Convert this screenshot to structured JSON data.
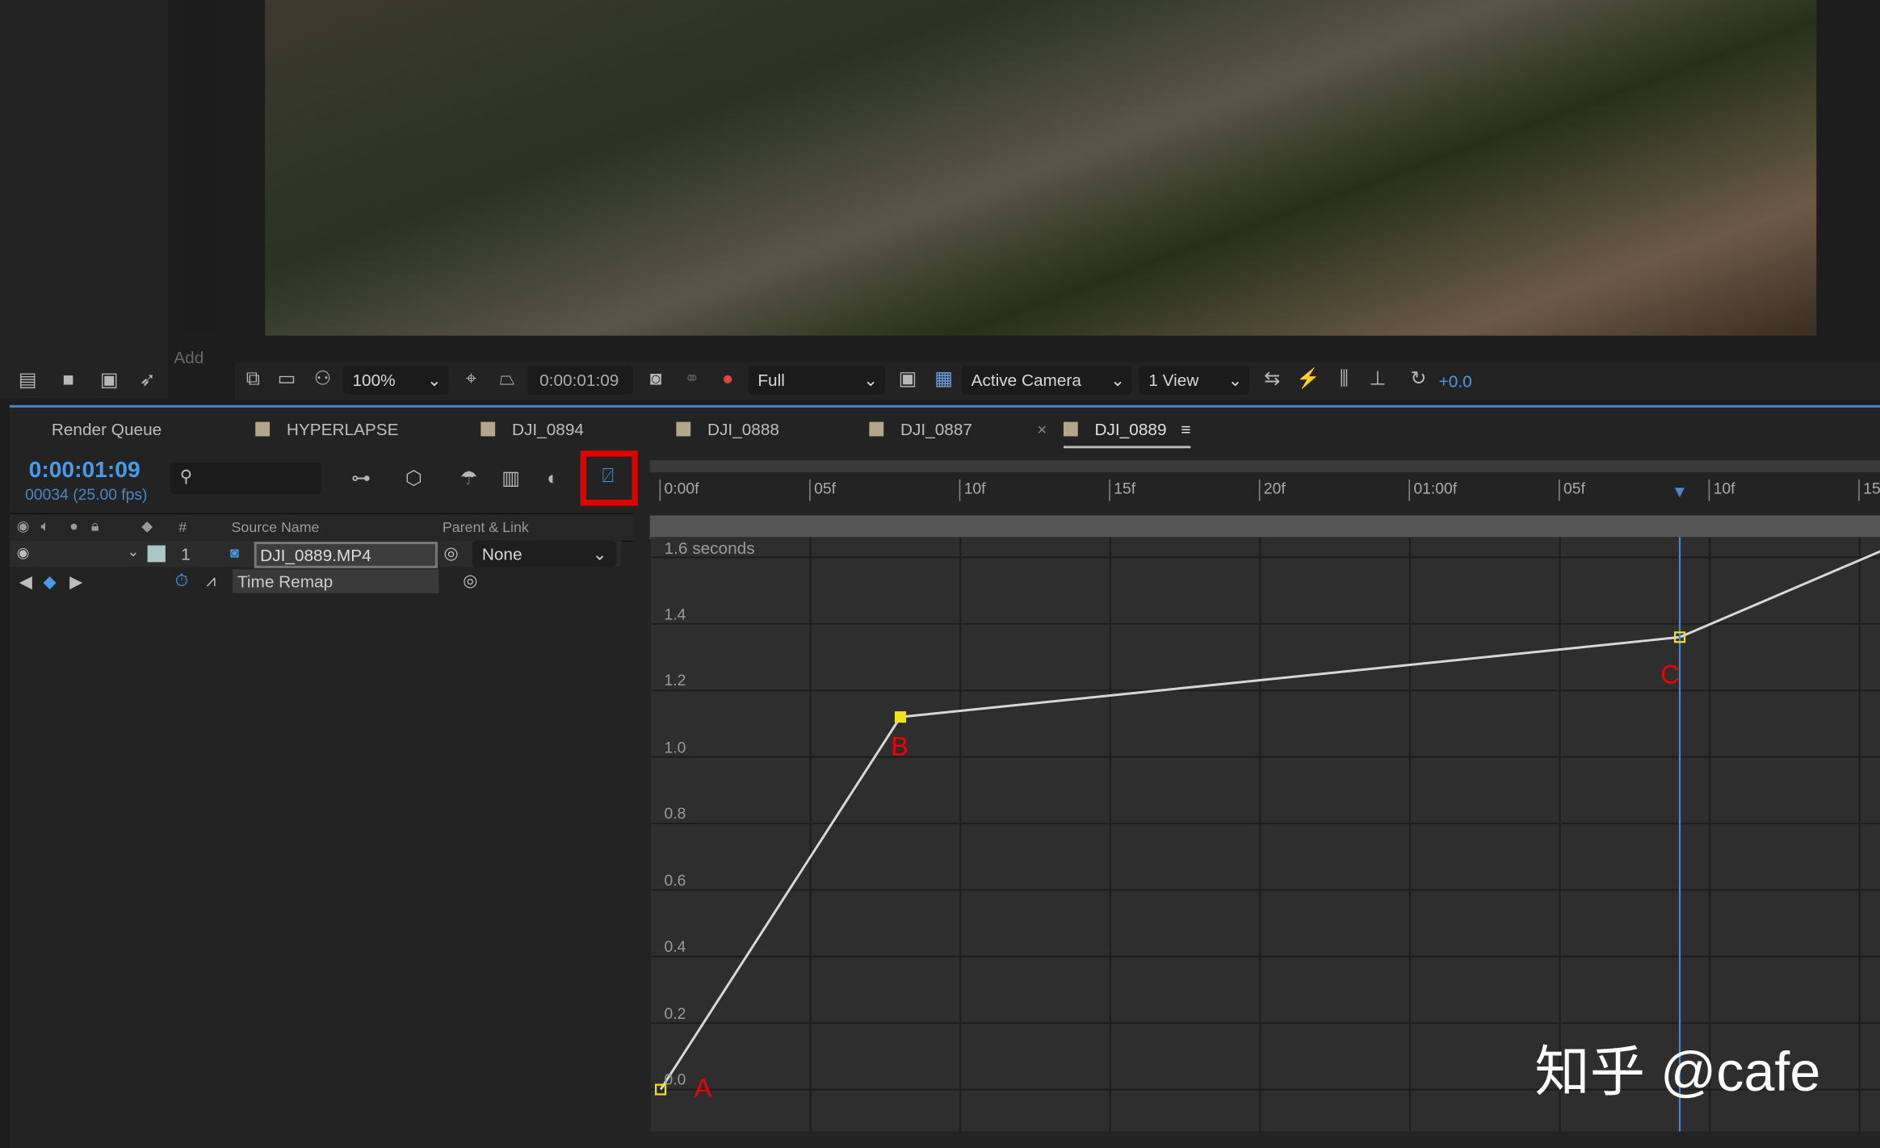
{
  "project_panel": {
    "add_label": "Add"
  },
  "viewer_toolbar": {
    "zoom": "100%",
    "timecode": "0:00:01:09",
    "resolution": "Full",
    "camera": "Active Camera",
    "views": "1 View",
    "exposure": "+0.0"
  },
  "tabs": [
    {
      "label": "Render Queue"
    },
    {
      "label": "HYPERLAPSE"
    },
    {
      "label": "DJI_0894"
    },
    {
      "label": "DJI_0888"
    },
    {
      "label": "DJI_0887"
    },
    {
      "label": "DJI_0889",
      "active": true
    }
  ],
  "timeline": {
    "current_time": "0:00:01:09",
    "frame_info": "00034 (25.00 fps)",
    "search_placeholder": "",
    "columns": {
      "number": "#",
      "source_name": "Source Name",
      "parent_link": "Parent & Link"
    },
    "layer": {
      "index": "1",
      "name": "DJI_0889.MP4",
      "parent": "None",
      "property": "Time Remap"
    },
    "ruler_labels": [
      "0:00f",
      "05f",
      "10f",
      "15f",
      "20f",
      "01:00f",
      "05f",
      "10f",
      "15f"
    ],
    "graph_editor_highlight": "#e00000"
  },
  "chart_data": {
    "type": "line",
    "ylabel": "1.6 seconds",
    "yticks": [
      "1.4",
      "1.2",
      "1.0",
      "0.8",
      "0.6",
      "0.4",
      "0.2",
      "0.0"
    ],
    "ylim": [
      0,
      1.6
    ],
    "x_unit": "frames",
    "fps": 25,
    "keyframes": [
      {
        "frame": 0,
        "value": 0.0,
        "label": "A"
      },
      {
        "frame": 8,
        "value": 1.12,
        "label": "B"
      },
      {
        "frame": 34,
        "value": 1.36,
        "label": "C"
      }
    ],
    "extension": {
      "frame": 41,
      "value": 1.63
    },
    "current_frame": 34,
    "line_color": "#d8d8d8",
    "keyframe_color": "#f2e21a"
  },
  "watermark": "知乎 @cafe"
}
